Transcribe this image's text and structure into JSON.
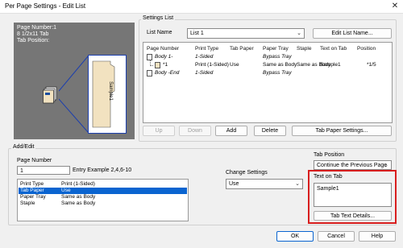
{
  "window": {
    "title": "Per Page Settings - Edit List",
    "close_icon": "close-icon"
  },
  "preview": {
    "line1": "Page Number:1",
    "line2": "8 1/2x11 Tab",
    "line3": "Tab Position:",
    "tab_text": "Sample1"
  },
  "settings_list": {
    "group_label": "Settings List",
    "list_name_label": "List Name",
    "list_name_value": "List 1",
    "edit_list_name_button": "Edit List Name...",
    "columns": [
      "Page Number",
      "Print Type",
      "Tab Paper",
      "Paper Tray",
      "Staple",
      "Text on Tab",
      "Position"
    ],
    "rows": [
      {
        "page": "Body 1-",
        "print_type": "1-Sided",
        "tab_paper": "",
        "paper_tray": "Bypass Tray",
        "staple": "",
        "text_on_tab": "",
        "position": "",
        "italic": true,
        "indent": false
      },
      {
        "page": "*1",
        "print_type": "Print (1-Sided)",
        "tab_paper": "Use",
        "paper_tray": "Same as Body",
        "staple": "Same as Body",
        "text_on_tab": "Sample1",
        "position": "*1/5",
        "italic": false,
        "indent": true
      },
      {
        "page": "Body -End",
        "print_type": "1-Sided",
        "tab_paper": "",
        "paper_tray": "Bypass Tray",
        "staple": "",
        "text_on_tab": "",
        "position": "",
        "italic": true,
        "indent": false
      }
    ],
    "buttons": {
      "up": "Up",
      "down": "Down",
      "add": "Add",
      "delete": "Delete",
      "tab_paper_settings": "Tab Paper Settings..."
    }
  },
  "add_edit": {
    "group_label": "Add/Edit",
    "page_number_label": "Page Number",
    "page_number_value": "1",
    "entry_example": "Entry Example 2,4,6-10",
    "items": [
      {
        "name": "Print Type",
        "value": "Print (1-Sided)",
        "selected": false
      },
      {
        "name": "Tab Paper",
        "value": "Use",
        "selected": true
      },
      {
        "name": "Paper Tray",
        "value": "Same as Body",
        "selected": false
      },
      {
        "name": "Staple",
        "value": "Same as Body",
        "selected": false
      }
    ],
    "change_settings_label": "Change Settings",
    "change_settings_value": "Use",
    "tab_position_label": "Tab Position",
    "tab_position_value": "Continue the Previous Page",
    "text_on_tab_label": "Text on Tab",
    "text_on_tab_value": "Sample1",
    "tab_text_details_button": "Tab Text Details..."
  },
  "footer": {
    "ok": "OK",
    "cancel": "Cancel",
    "help": "Help"
  },
  "colors": {
    "highlight": "#d81e1e",
    "selection": "#0a64d0",
    "preview_bg": "#767676",
    "tab_paper": "#f2e2c0"
  }
}
